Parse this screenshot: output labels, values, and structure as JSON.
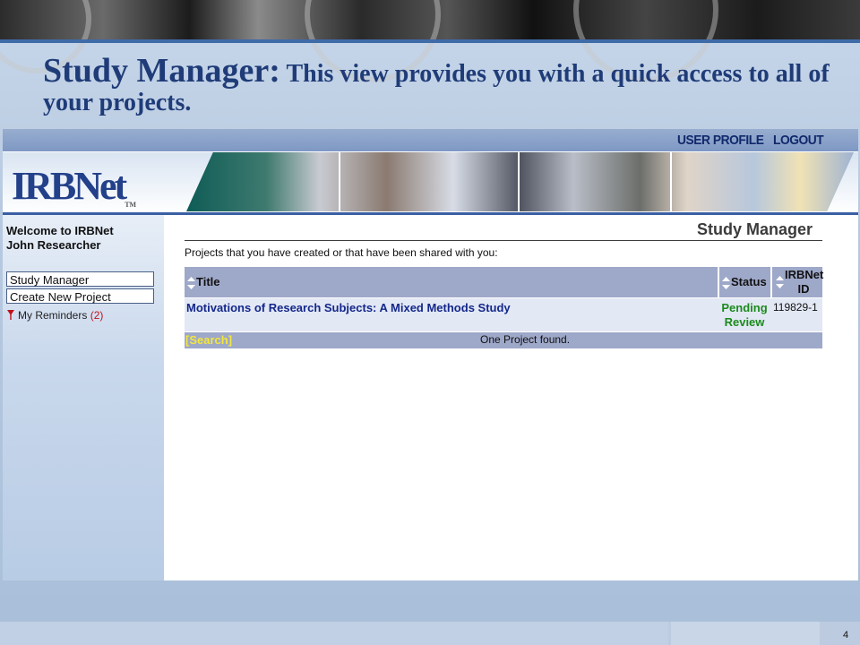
{
  "slide": {
    "title_main": "Study Manager:",
    "title_sub": " This view provides you with a quick access to all of your projects.",
    "page_number": "4"
  },
  "app": {
    "top_links": {
      "user_profile": "USER PROFILE",
      "logout": "LOGOUT"
    },
    "logo": {
      "text": "IRBNet",
      "tm": "TM"
    },
    "sidebar": {
      "welcome_line1": "Welcome to IRBNet",
      "welcome_line2": "John Researcher",
      "buttons": [
        "Study Manager",
        "Create New Project"
      ],
      "reminders_label": "My Reminders",
      "reminders_count": "(2)"
    },
    "main": {
      "title": "Study Manager",
      "intro": "Projects that you have created or that have been shared with you:",
      "table": {
        "headers": {
          "title": "Title",
          "status": "Status",
          "id_line1": "IRBNet",
          "id_line2": "ID"
        },
        "rows": [
          {
            "title": "Motivations of Research Subjects: A Mixed Methods Study",
            "status_line1": "Pending",
            "status_line2": "Review",
            "id": "119829-1"
          }
        ],
        "search_link": "[Search]",
        "found_text": "One Project found."
      }
    }
  },
  "colors": {
    "title_blue": "#1f3c78",
    "link_blue": "#14288a",
    "status_green": "#1c8a1c",
    "search_yellow": "#f3e63d",
    "table_header": "#9ea8c9",
    "reminder_red": "#c0121b"
  },
  "icons": [
    "sort-arrows-icon",
    "reminder-flag-icon"
  ]
}
